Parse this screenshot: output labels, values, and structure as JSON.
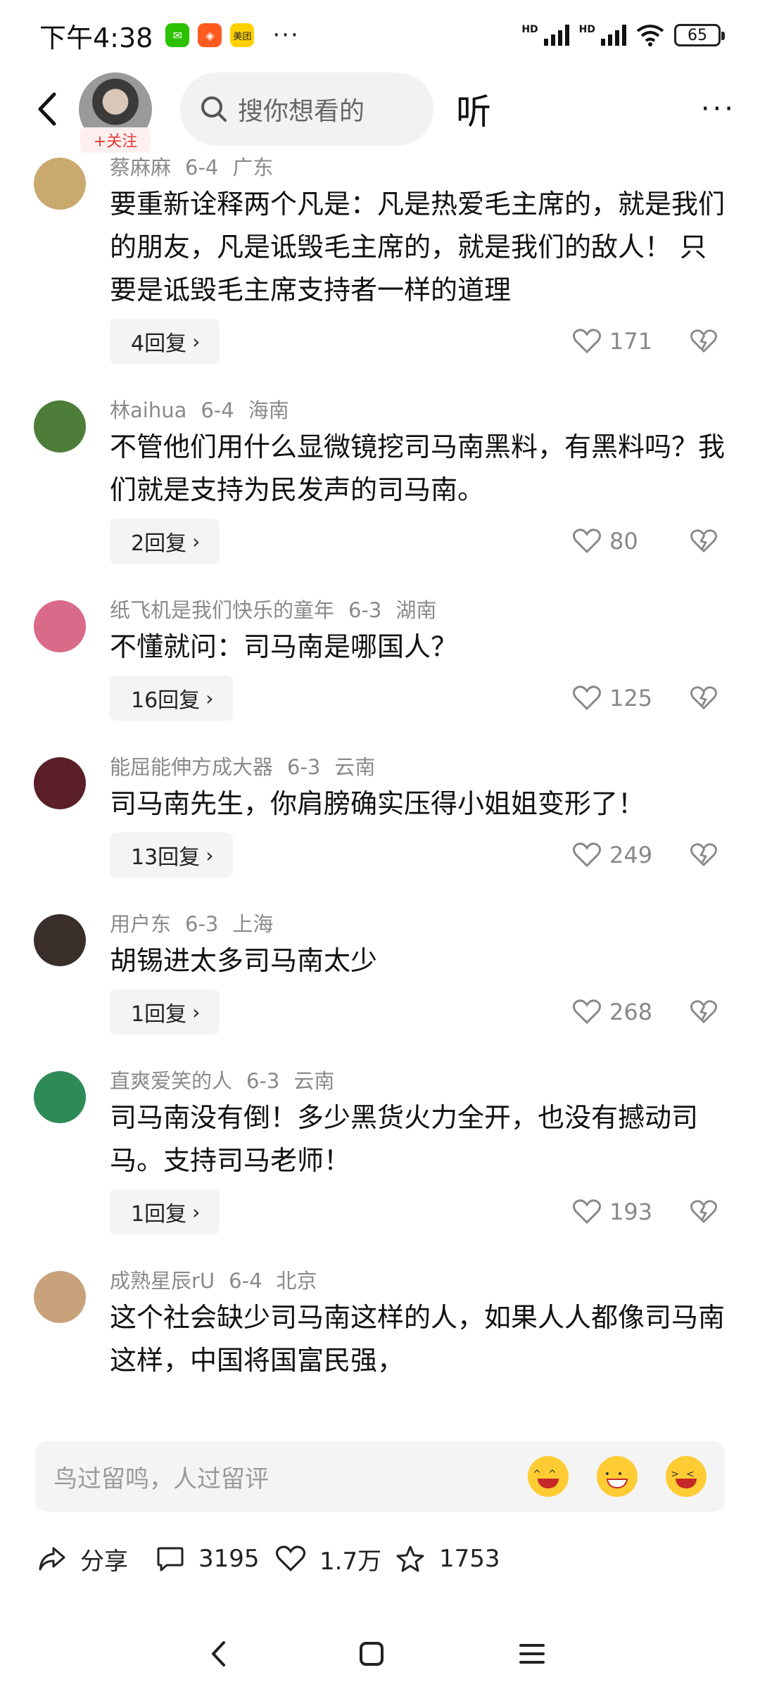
{
  "status_bar": {
    "time": "下午4:38",
    "apps": [
      "wechat-icon",
      "store-icon",
      "meituan-icon"
    ],
    "meituan_label": "美团",
    "more": "···",
    "hd1": "HD",
    "hd2": "HD",
    "battery": "65"
  },
  "header": {
    "follow_label": "+关注",
    "search_placeholder": "搜你想看的",
    "listen_label": "听",
    "more_label": "···"
  },
  "comments": [
    {
      "user": "蔡麻麻",
      "date": "6-4",
      "region": "广东",
      "text": "要重新诠释两个凡是：凡是热爱毛主席的，就是我们的朋友，凡是诋毁毛主席的，就是我们的敌人！ 只要是诋毁毛主席支持者一样的道理",
      "replies": "4回复",
      "likes": "171",
      "avatar_color": "#c9a96e"
    },
    {
      "user": "林aihua",
      "date": "6-4",
      "region": "海南",
      "text": "不管他们用什么显微镜挖司马南黑料，有黑料吗？我们就是支持为民发声的司马南。",
      "replies": "2回复",
      "likes": "80",
      "avatar_color": "#4e7d3a"
    },
    {
      "user": "纸飞机是我们快乐的童年",
      "date": "6-3",
      "region": "湖南",
      "text": "不懂就问：司马南是哪国人？",
      "replies": "16回复",
      "likes": "125",
      "avatar_color": "#d96a8a"
    },
    {
      "user": "能屈能伸方成大器",
      "date": "6-3",
      "region": "云南",
      "text": "司马南先生，你肩膀确实压得小姐姐变形了！",
      "replies": "13回复",
      "likes": "249",
      "avatar_color": "#5a1f28"
    },
    {
      "user": "用户东",
      "date": "6-3",
      "region": "上海",
      "text": "胡锡进太多司马南太少",
      "replies": "1回复",
      "likes": "268",
      "avatar_color": "#3a2e2a"
    },
    {
      "user": "直爽爱笑的人",
      "date": "6-3",
      "region": "云南",
      "text": "司马南没有倒！多少黑货火力全开，也没有撼动司马。支持司马老师！",
      "replies": "1回复",
      "likes": "193",
      "avatar_color": "#2e8b57"
    },
    {
      "user": "成熟星辰rU",
      "date": "6-4",
      "region": "北京",
      "text": "这个社会缺少司马南这样的人，如果人人都像司马南这样，中国将国富民强，",
      "replies": "",
      "likes": "",
      "avatar_color": "#c8a27a"
    }
  ],
  "input_bar": {
    "placeholder": "鸟过留鸣，人过留评"
  },
  "actions": {
    "share": "分享",
    "comments": "3195",
    "likes": "1.7万",
    "favorites": "1753"
  }
}
